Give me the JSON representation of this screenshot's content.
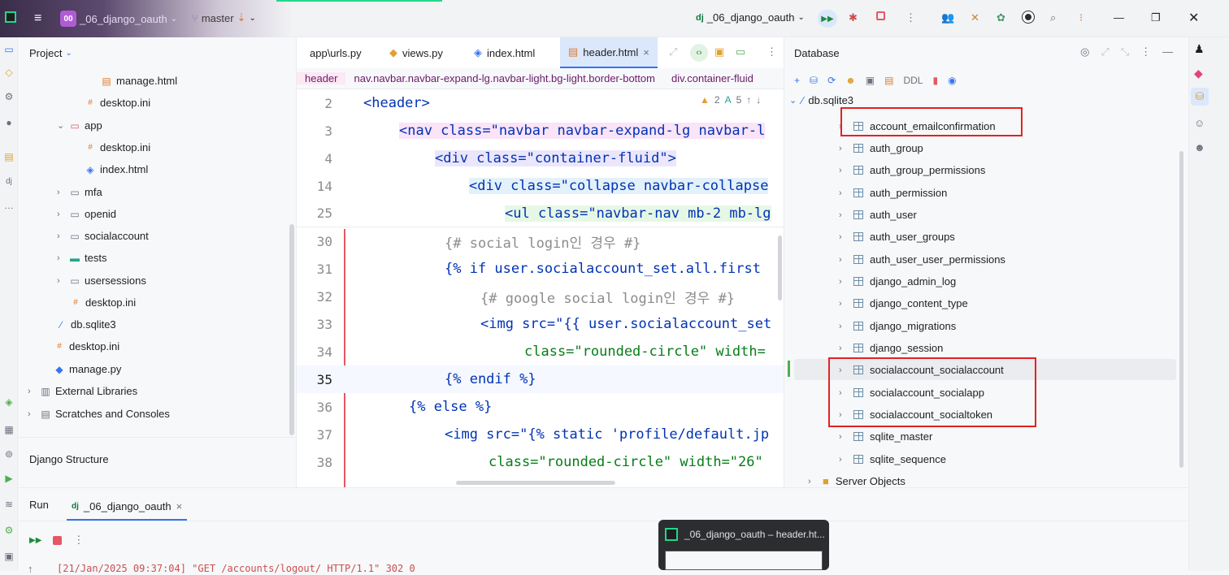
{
  "titlebar": {
    "project_badge": "00",
    "project_name": "_06_django_oauth",
    "branch": "master",
    "run_config": "_06_django_oauth"
  },
  "project_pane": {
    "title": "Project",
    "items": [
      {
        "label": "manage.html",
        "icon": "html-file-icon"
      },
      {
        "label": "desktop.ini",
        "icon": "ini-file-icon"
      },
      {
        "label": "app",
        "icon": "folder-icon"
      },
      {
        "label": "desktop.ini",
        "icon": "ini-file-icon"
      },
      {
        "label": "index.html",
        "icon": "html-file-icon"
      },
      {
        "label": "mfa",
        "icon": "folder-icon"
      },
      {
        "label": "openid",
        "icon": "folder-icon"
      },
      {
        "label": "socialaccount",
        "icon": "folder-icon"
      },
      {
        "label": "tests",
        "icon": "test-folder-icon"
      },
      {
        "label": "usersessions",
        "icon": "folder-icon"
      },
      {
        "label": "desktop.ini",
        "icon": "ini-file-icon"
      },
      {
        "label": "db.sqlite3",
        "icon": "sqlite-icon"
      },
      {
        "label": "desktop.ini",
        "icon": "ini-file-icon"
      },
      {
        "label": "manage.py",
        "icon": "python-file-icon"
      },
      {
        "label": "External Libraries",
        "icon": "library-icon"
      },
      {
        "label": "Scratches and Consoles",
        "icon": "scratch-icon"
      }
    ],
    "django_structure": "Django Structure"
  },
  "editor": {
    "tabs": [
      {
        "label": "app\\urls.py"
      },
      {
        "label": "views.py"
      },
      {
        "label": "index.html"
      },
      {
        "label": "header.html",
        "close": "×"
      }
    ],
    "breadcrumb": [
      "header",
      "nav.navbar.navbar-expand-lg.navbar-light.bg-light.border-bottom",
      "div.container-fluid"
    ],
    "warnings": "2",
    "typos": "5",
    "lines": [
      {
        "num": "2",
        "code": "<header>"
      },
      {
        "num": "3",
        "code": "<nav class=\"navbar navbar-expand-lg navbar-l"
      },
      {
        "num": "4",
        "code": "<div class=\"container-fluid\">"
      },
      {
        "num": "14",
        "code": "<div class=\"collapse navbar-collapse"
      },
      {
        "num": "25",
        "code": "<ul class=\"navbar-nav mb-2 mb-lg"
      },
      {
        "num": "30",
        "code": "{# social login인 경우 #}"
      },
      {
        "num": "31",
        "code": "{% if user.socialaccount_set.all.first"
      },
      {
        "num": "32",
        "code": "{# google social login인 경우 #}"
      },
      {
        "num": "33",
        "code": "<img src=\"{{ user.socialaccount_set"
      },
      {
        "num": "34",
        "code": "class=\"rounded-circle\" width="
      },
      {
        "num": "35",
        "code": "{% endif %}"
      },
      {
        "num": "36",
        "code": "{% else %}"
      },
      {
        "num": "37",
        "code": "<img src=\"{% static 'profile/default.jp"
      },
      {
        "num": "38",
        "code": "class=\"rounded-circle\" width=\"26\""
      }
    ]
  },
  "database": {
    "title": "Database",
    "toolbar_ddl": "DDL",
    "root": "db.sqlite3",
    "tables": [
      "account_emailconfirmation",
      "auth_group",
      "auth_group_permissions",
      "auth_permission",
      "auth_user",
      "auth_user_groups",
      "auth_user_user_permissions",
      "django_admin_log",
      "django_content_type",
      "django_migrations",
      "django_session",
      "socialaccount_socialaccount",
      "socialaccount_socialapp",
      "socialaccount_socialtoken",
      "sqlite_master",
      "sqlite_sequence"
    ],
    "server_objects": "Server Objects"
  },
  "run": {
    "title": "Run",
    "config_tab": "_06_django_oauth",
    "log_line": "[21/Jan/2025 09:37:04] \"GET /accounts/logout/ HTTP/1.1\" 302 0"
  },
  "popup": {
    "title": "_06_django_oauth – header.ht..."
  },
  "colors": {
    "accent": "#3574f0",
    "highlight_box": "#e32222",
    "project_badge": "#b05bd6"
  }
}
